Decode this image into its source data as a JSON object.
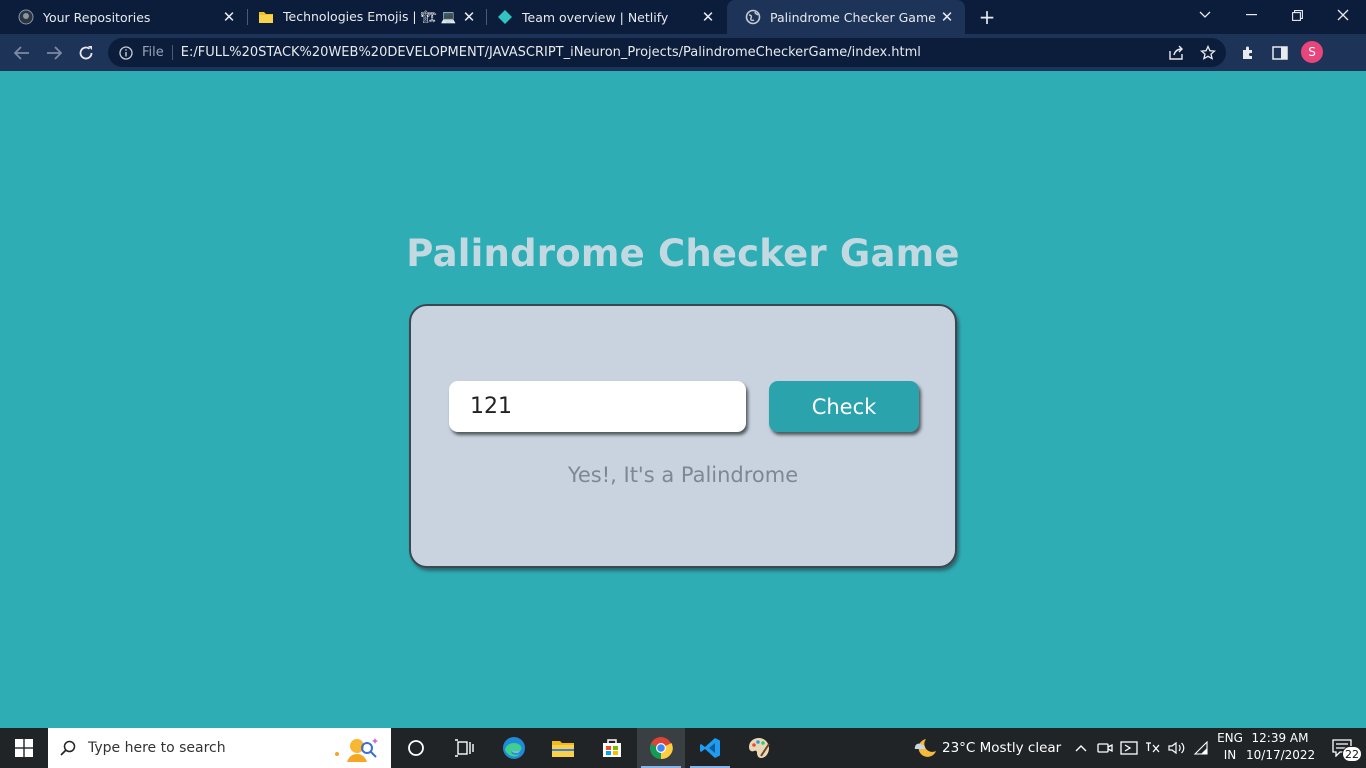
{
  "browser": {
    "tabs": [
      {
        "label": "Your Repositories",
        "icon": "github-icon",
        "active": false
      },
      {
        "label": "Technologies Emojis | 🏗 💻 📟 ⚒",
        "icon": "folder-icon",
        "active": false
      },
      {
        "label": "Team overview | Netlify",
        "icon": "netlify-icon",
        "active": false
      },
      {
        "label": "Palindrome Checker Game",
        "icon": "globe-icon",
        "active": true
      }
    ],
    "address": {
      "scheme_label": "File",
      "url": "E:/FULL%20STACK%20WEB%20DEVELOPMENT/JAVASCRIPT_iNeuron_Projects/PalindromeCheckerGame/index.html"
    },
    "profile_initial": "S"
  },
  "app": {
    "title": "Palindrome Checker Game",
    "input_value": "121",
    "button_label": "Check",
    "result_text": "Yes!, It's a Palindrome",
    "colors": {
      "background": "#2eadb5",
      "card": "#c9d3df",
      "button": "#2aa3ad",
      "title": "#c3d9e2",
      "result": "#7e8891"
    }
  },
  "taskbar": {
    "search_placeholder": "Type here to search",
    "weather": "23°C  Mostly clear",
    "language_line1": "ENG",
    "language_line2": "IN",
    "time": "12:39 AM",
    "date": "10/17/2022",
    "notification_count": "22"
  }
}
